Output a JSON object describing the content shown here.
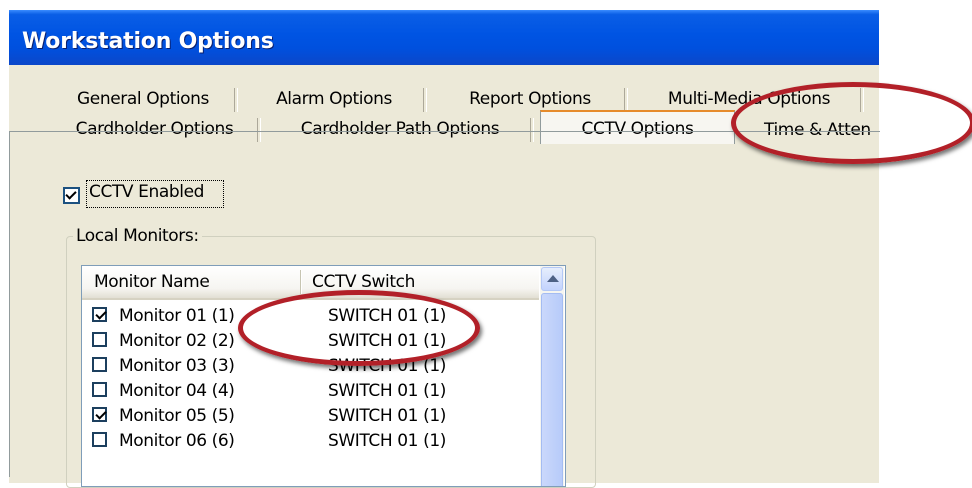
{
  "window": {
    "title": "Workstation Options"
  },
  "tabs": {
    "row1": [
      "General Options",
      "Alarm Options",
      "Report Options",
      "Multi-Media Options"
    ],
    "row2": [
      "Cardholder Options",
      "Cardholder Path Options",
      "CCTV Options",
      "Time & Atten"
    ],
    "selected": "CCTV Options"
  },
  "cctv_enabled": {
    "label": "CCTV Enabled",
    "checked": true
  },
  "local_monitors": {
    "title": "Local Monitors:",
    "columns": [
      "Monitor Name",
      "CCTV Switch"
    ],
    "rows": [
      {
        "name": "Monitor 01 (1)",
        "switch": "SWITCH 01 (1)",
        "checked": true
      },
      {
        "name": "Monitor 02 (2)",
        "switch": "SWITCH 01 (1)",
        "checked": false
      },
      {
        "name": "Monitor 03 (3)",
        "switch": "SWITCH 01 (1)",
        "checked": false
      },
      {
        "name": "Monitor 04 (4)",
        "switch": "SWITCH 01 (1)",
        "checked": false
      },
      {
        "name": "Monitor 05 (5)",
        "switch": "SWITCH 01 (1)",
        "checked": true
      },
      {
        "name": "Monitor 06 (6)",
        "switch": "SWITCH 01 (1)",
        "checked": false
      }
    ]
  },
  "colors": {
    "title_bar": "#0054e3",
    "selected_tab_accent": "#e68b2c",
    "annotation_ellipse": "#b22028",
    "dialog_background": "#ece9d8"
  }
}
